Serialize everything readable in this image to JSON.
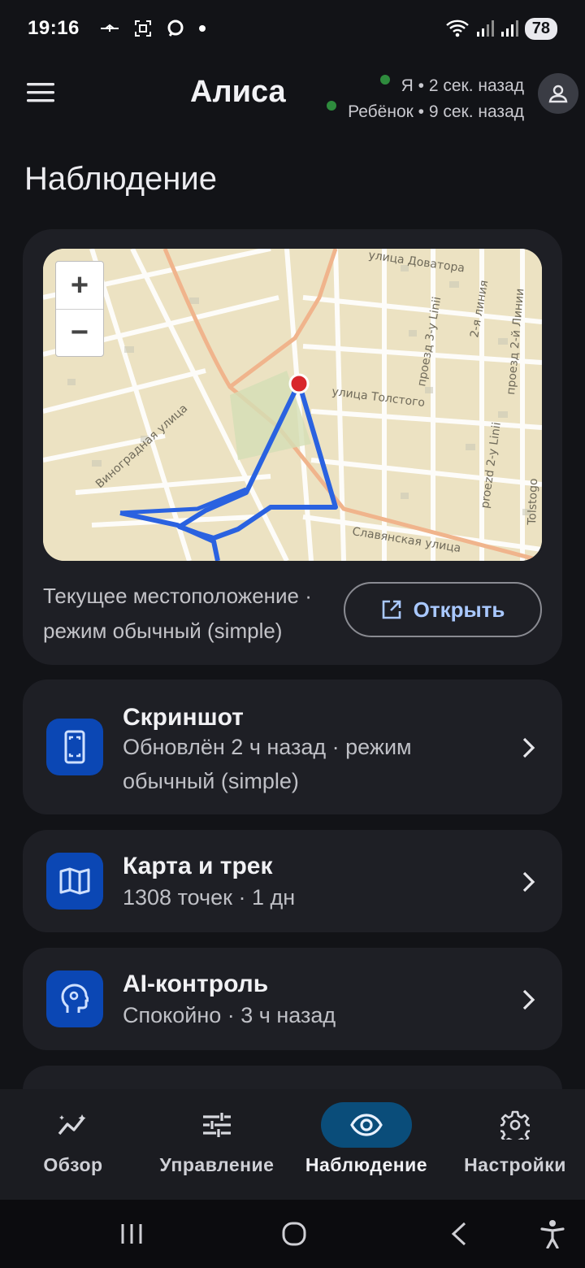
{
  "status": {
    "time": "19:16",
    "battery": "78"
  },
  "header": {
    "title": "Алиса",
    "presence": [
      {
        "text": "Я • 2 сек. назад",
        "color": "#2e8b3d"
      },
      {
        "text": "Ребёнок • 9 сек. назад",
        "color": "#2e8b3d"
      }
    ]
  },
  "section_title": "Наблюдение",
  "map_card": {
    "zoom_in": "+",
    "zoom_out": "−",
    "street_labels": [
      "улица Доватора",
      "улица Толстого",
      "Виноградная улица",
      "Славянская улица",
      "2-я линия",
      "проезд 2-й Линии",
      "проезд 3-у Linii",
      "proezd 2-y Linii",
      "Tolstogo"
    ],
    "caption": "Текущее местоположение · режим обычный (simple)",
    "open_label": "Открыть"
  },
  "cards": [
    {
      "title": "Скриншот",
      "subtitle": "Обновлён 2 ч назад · режим обычный (simple)",
      "icon": "phone-screenshot-icon"
    },
    {
      "title": "Карта и трек",
      "subtitle": "1308 точек · 1 дн",
      "icon": "map-icon"
    },
    {
      "title": "AI-контроль",
      "subtitle": "Спокойно · 3 ч назад",
      "icon": "ai-head-icon"
    }
  ],
  "bottom_nav": [
    {
      "label": "Обзор",
      "icon": "overview-icon",
      "active": false
    },
    {
      "label": "Управление",
      "icon": "sliders-icon",
      "active": false
    },
    {
      "label": "Наблюдение",
      "icon": "eye-icon",
      "active": true
    },
    {
      "label": "Настройки",
      "icon": "gear-icon",
      "active": false
    }
  ],
  "colors": {
    "accent": "#0a4d7a",
    "card_icon_bg": "#0b47b4",
    "link": "#a9c8ff",
    "track": "#2a62e0",
    "marker": "#d8262c"
  }
}
